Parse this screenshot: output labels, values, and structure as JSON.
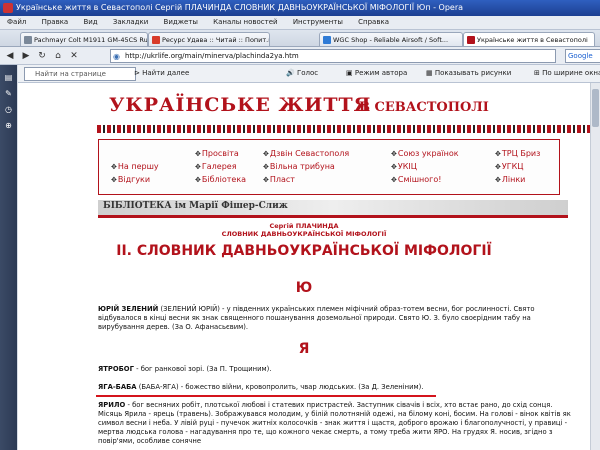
{
  "window": {
    "title": "Українське життя в Севастополі Сергій ПЛАЧИНДА СЛОВНИК ДАВНЬОУКРАЇНСЬКОЇ МІФОЛОГІЇ Юп - Opera"
  },
  "menu": [
    "Файл",
    "Правка",
    "Вид",
    "Закладки",
    "Виджеты",
    "Каналы новостей",
    "Инструменты",
    "Справка"
  ],
  "tabs": [
    {
      "label": "Pachmayr Colt M1911 GM-45CS Ru..."
    },
    {
      "label": "Ресурс Удава :: Читай :: Попит.ru"
    },
    {
      "label": "WGC Shop - Reliable Airsoft / Soft..."
    },
    {
      "label": "Українське життя в Севастополі"
    }
  ],
  "address": {
    "url": "http://ukrlife.org/main/minerva/plachinda2ya.htm",
    "search": "Google"
  },
  "findbar": {
    "find_placeholder": "Найти на странице",
    "find_next": "Найти далее",
    "voice": "Голос",
    "author_mode": "Режим автора",
    "show_images": "Показывать рисунки",
    "fit_width": "По ширине окна"
  },
  "banner": {
    "title": "УКРАЇНСЬКЕ ЖИТТЯ",
    "subtitle": "В СЕВАСТОПОЛІ"
  },
  "nav": {
    "col1": [
      "На першу",
      "Відгуки"
    ],
    "col2": [
      "Просвіта",
      "Галерея",
      "Бібліотека"
    ],
    "col3": [
      "Дзвін Севастополя",
      "Вільна трибуна",
      "Пласт"
    ],
    "col4": [
      "Союз українок",
      "УКІЦ",
      "Смішного!"
    ],
    "col5": [
      "ТРЦ Бриз",
      "УГКЦ",
      "Лінки"
    ]
  },
  "library_banner": "БІБЛІОТЕКА ім Марії Фішер-Слиж",
  "article": {
    "author": "Сергій ПЛАЧИНДА",
    "subtitle": "СЛОВНИК ДАВНЬОУКРАЇНСЬКОЇ МІФОЛОГІЇ",
    "heading": "ІІ. СЛОВНИК ДАВНЬОУКРАЇНСЬКОЇ МІФОЛОГІЇ",
    "letter_yu": "Ю",
    "p1_term": "ЮРІЙ ЗЕЛЕНИЙ",
    "p1_text": " (ЗЕЛЕНИЙ ЮРІЙ) - у південних українських племен міфічний образ-тотем весни, бог рослинності. Свято відбувалося в кінці весни як знак священного пошанування доземольної природи. Свято Ю. З. було своєрідним табу на вирубування дерев. (За О. Афанасьєвим).",
    "letter_ya": "Я",
    "p2_term": "ЯТРОБОГ",
    "p2_text": " - бог ранкової зорі. (За П. Трощиним).",
    "p3_term": "ЯГА-БАБА",
    "p3_text": " (БАБА-ЯГА) - божество війни, кровопролить, чвар людських. (За Д. Зеленіним).",
    "p4_term": "ЯРИЛО",
    "p4_text": " - бог весняних робіт, плотської любові і статевих пристрастей. Заступник сівачів і всіх, хто встає рано, до схід сонця. Місяць Ярила - ярець (травень). Зображувався молодим, у білій полотняній одежі, на білому коні, босим. На голові - вінок квітів як символ весни і неба. У лівій руці - пучечок житніх колосочків - знак життя і щастя, доброго врожаю і благополучності, у правиці - мертва людська голова - нагадування про те, що кожного чекає смерть, а тому треба жити ЯРО. На грудях Я. носив, згідно з повір'ями, особливе сонячне"
  },
  "colors": {
    "accent_red": "#b2121b",
    "title_bar": "#2f5fbf"
  }
}
